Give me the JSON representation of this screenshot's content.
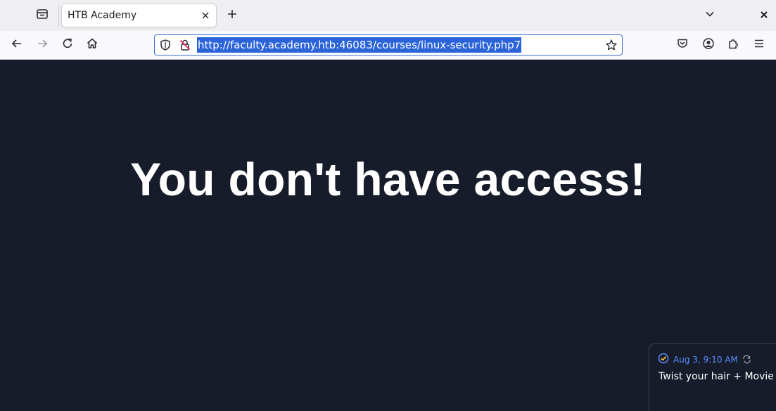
{
  "browser": {
    "tab": {
      "title": "HTB Academy"
    },
    "url": "http://faculty.academy.htb:46083/courses/linux-security.php7"
  },
  "page": {
    "headline": "You don't have access!"
  },
  "notification": {
    "time": "Aug 3, 9:10 AM",
    "text": "Twist your hair + Movie [e"
  },
  "colors": {
    "page_background": "#161c2a",
    "url_selection": "#2b63d9",
    "notification_accent": "#5b8cff"
  },
  "icons": [
    "tab-list-icon",
    "close-icon",
    "plus-icon",
    "chevron-down-icon",
    "window-close-icon",
    "back-arrow-icon",
    "forward-arrow-icon",
    "reload-icon",
    "home-icon",
    "shield-icon",
    "insecure-lock-icon",
    "star-icon",
    "pocket-icon",
    "account-icon",
    "extensions-icon",
    "menu-icon",
    "check-circle-icon",
    "repeat-icon"
  ]
}
